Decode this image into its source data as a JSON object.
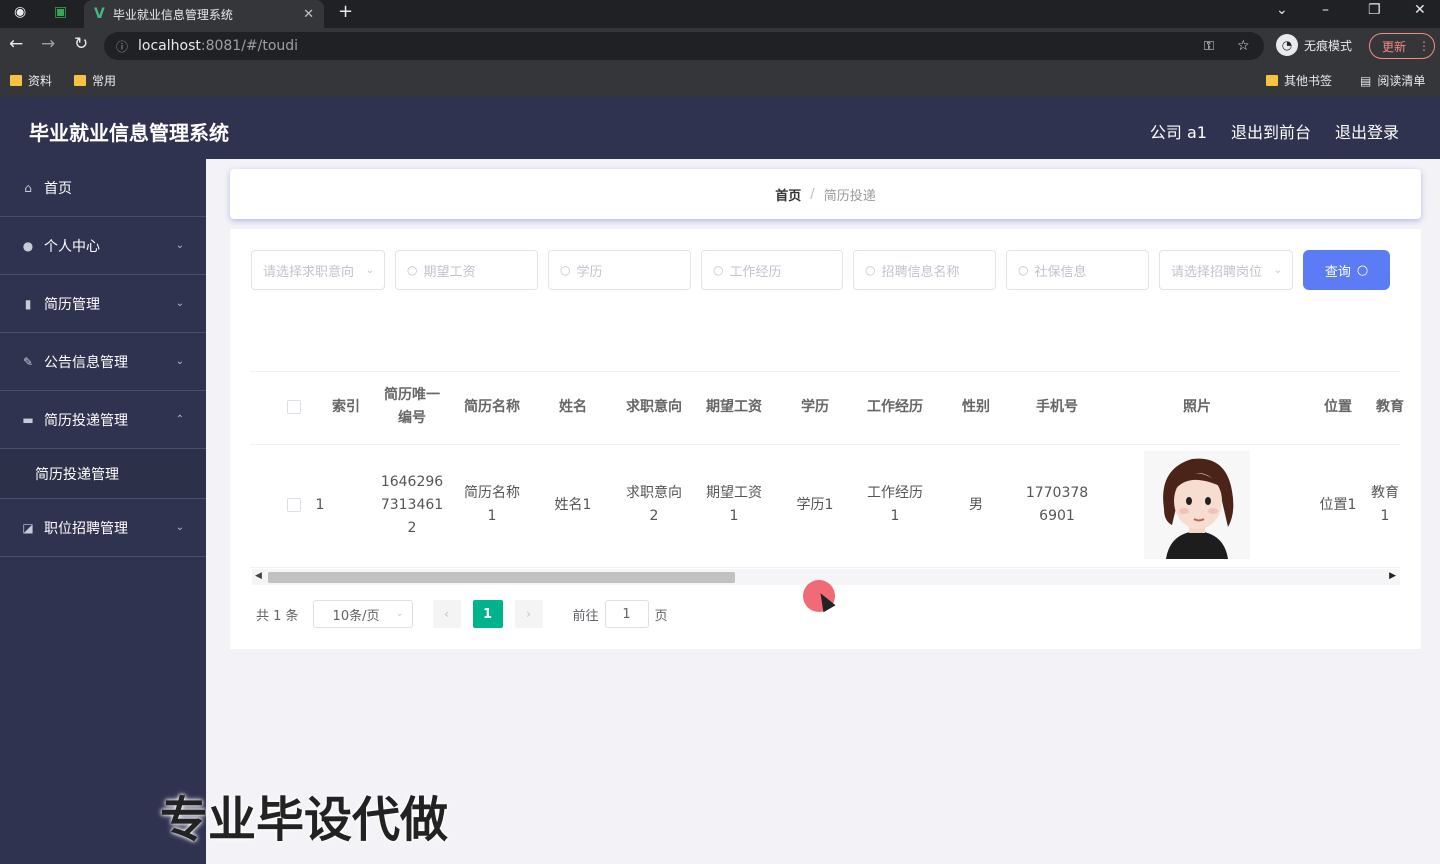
{
  "browser": {
    "tab_title": "毕业就业信息管理系统",
    "url_host": "localhost",
    "url_rest": ":8081/#/toudi",
    "incognito_label": "无痕模式",
    "update_label": "更新",
    "bookmarks": [
      "资料",
      "常用"
    ],
    "bookmarks_right": [
      "其他书签",
      "阅读清单"
    ]
  },
  "app": {
    "title": "毕业就业信息管理系统",
    "header_links": [
      "公司 a1",
      "退出到前台",
      "退出登录"
    ]
  },
  "sidebar": {
    "items": [
      {
        "label": "首页",
        "icon": "home-icon"
      },
      {
        "label": "个人中心",
        "icon": "user-icon"
      },
      {
        "label": "简历管理",
        "icon": "chart-icon"
      },
      {
        "label": "公告信息管理",
        "icon": "bell-icon"
      },
      {
        "label": "简历投递管理",
        "icon": "monitor-icon"
      },
      {
        "label": "职位招聘管理",
        "icon": "trend-icon"
      }
    ],
    "submenu_label": "简历投递管理"
  },
  "breadcrumb": {
    "home": "首页",
    "current": "简历投递"
  },
  "filters": {
    "job_intent_placeholder": "请选择求职意向",
    "salary_placeholder": "期望工资",
    "education_placeholder": "学历",
    "experience_placeholder": "工作经历",
    "recruit_name_placeholder": "招聘信息名称",
    "social_placeholder": "社保信息",
    "recruit_select_placeholder": "请选择招聘岗位",
    "query_label": "查询"
  },
  "table": {
    "headers": [
      "索引",
      "简历唯一编号",
      "简历名称",
      "姓名",
      "求职意向",
      "期望工资",
      "学历",
      "工作经历",
      "性别",
      "手机号",
      "照片",
      "位置",
      "教育"
    ],
    "row": {
      "index": "1",
      "resume_id": "16462967313461 2",
      "resume_name": "简历名称1",
      "name": "姓名1",
      "job_intent": "求职意向2",
      "salary": "期望工资1",
      "education": "学历1",
      "experience": "工作经历1",
      "gender": "男",
      "phone": "17703786901",
      "location": "位置1",
      "edu_extra": "教育1"
    }
  },
  "pagination": {
    "total": "共 1 条",
    "page_size": "10条/页",
    "current_page": "1",
    "goto_label": "前往",
    "goto_value": "1",
    "page_suffix": "页"
  },
  "watermark": "专业毕设代做"
}
